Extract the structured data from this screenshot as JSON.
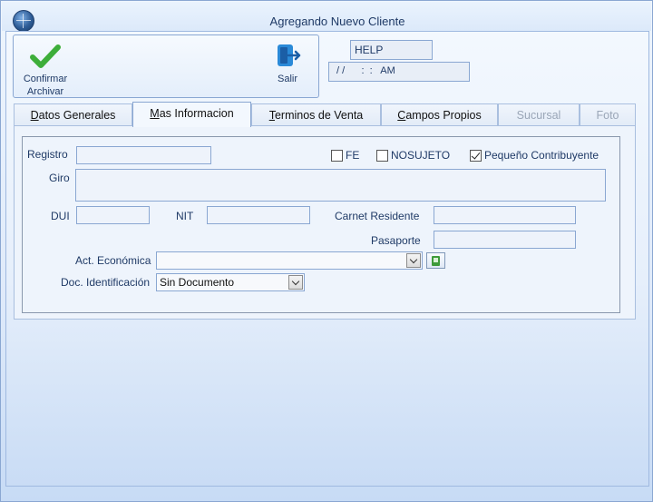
{
  "window": {
    "title": "Agregando Nuevo Cliente"
  },
  "toolbar": {
    "confirm_label_1": "Confirmar",
    "confirm_label_2": "Archivar",
    "exit_label": "Salir"
  },
  "header": {
    "help_text": "HELP",
    "datetime_text": "/ /      :  :   AM"
  },
  "tabs": [
    {
      "label": "Datos Generales",
      "underline": "D",
      "rest": "atos Generales"
    },
    {
      "label": "Mas Informacion",
      "underline": "M",
      "rest": "as Informacion"
    },
    {
      "label": "Terminos de Venta",
      "underline": "T",
      "rest": "erminos de Venta"
    },
    {
      "label": "Campos Propios",
      "underline": "C",
      "rest": "ampos Propios"
    },
    {
      "label": "Sucursal"
    },
    {
      "label": "Foto"
    }
  ],
  "form": {
    "registro_label": "Registro",
    "registro_value": "",
    "fe_label": "FE",
    "fe_checked": false,
    "nosujeto_label": "NOSUJETO",
    "nosujeto_checked": false,
    "pequeno_label": "Pequeño Contribuyente",
    "pequeno_checked": true,
    "giro_label": "Giro",
    "giro_value": "",
    "dui_label": "DUI",
    "dui_value": "",
    "nit_label": "NIT",
    "nit_value": "",
    "carnet_label": "Carnet Residente",
    "carnet_value": "",
    "pasaporte_label": "Pasaporte",
    "pasaporte_value": "",
    "act_economica_label": "Act. Económica",
    "act_economica_value": "",
    "doc_ident_label": "Doc. Identificación",
    "doc_ident_value": "Sin Documento"
  },
  "icons": {
    "app": "app-globe-icon",
    "confirm": "green-checkmark-icon",
    "exit": "exit-door-icon",
    "add": "add-document-icon"
  },
  "colors": {
    "accent": "#2a8ad8",
    "check_green": "#3dae3a",
    "border": "#8aa7d2",
    "label_text": "#1f3a66"
  }
}
